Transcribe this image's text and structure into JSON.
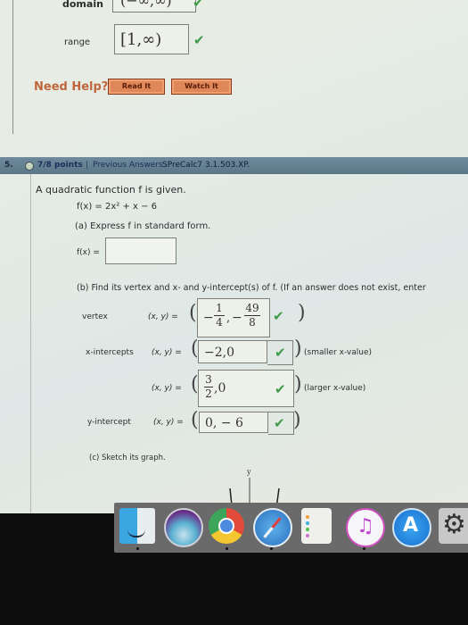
{
  "top_section": {
    "domain_label": "domain",
    "domain_value": "(−∞,∞)",
    "range_label": "range",
    "range_value": "[1,∞)",
    "need_help": "Need Help?",
    "read_it": "Read It",
    "watch_it": "Watch It"
  },
  "question": {
    "number": "5.",
    "points": "7/8 points",
    "separator": "|",
    "previous_answers": "Previous Answers",
    "code": "SPreCalc7 3.1.503.XP.",
    "intro": "A quadratic function f is given.",
    "function": "f(x) = 2x² + x − 6",
    "part_a": "(a) Express f in standard form.",
    "fx_label": "f(x) =",
    "fx_value": "",
    "part_b": "(b) Find its vertex and x- and y-intercept(s) of f. (If an answer does not exist, enter",
    "xy_label": "(x, y) =",
    "vertex": {
      "label": "vertex",
      "x_sign": "−",
      "x_num": "1",
      "x_den": "4",
      "y_sign": "−",
      "y_num": "49",
      "y_den": "8",
      "status": "correct"
    },
    "x_intercepts": {
      "label": "x-intercepts",
      "first_value": "−2,0",
      "first_note": "(smaller x-value)",
      "second_num": "3",
      "second_den": "2",
      "second_rest": ",0",
      "second_note": "(larger x-value)",
      "status": "correct"
    },
    "y_intercept": {
      "label": "y-intercept",
      "value": "0, − 6",
      "status": "correct"
    },
    "part_c": "(c) Sketch its graph.",
    "graph_axis_label": "y"
  },
  "dock": {
    "items": [
      "Finder",
      "Siri",
      "Chrome",
      "Safari",
      "Reminders",
      "iTunes",
      "App Store",
      "System Preferences"
    ]
  },
  "colors": {
    "correct_check": "#3f9a4a",
    "need_help": "#c0663c",
    "question_bar": "#5f7b8c"
  }
}
